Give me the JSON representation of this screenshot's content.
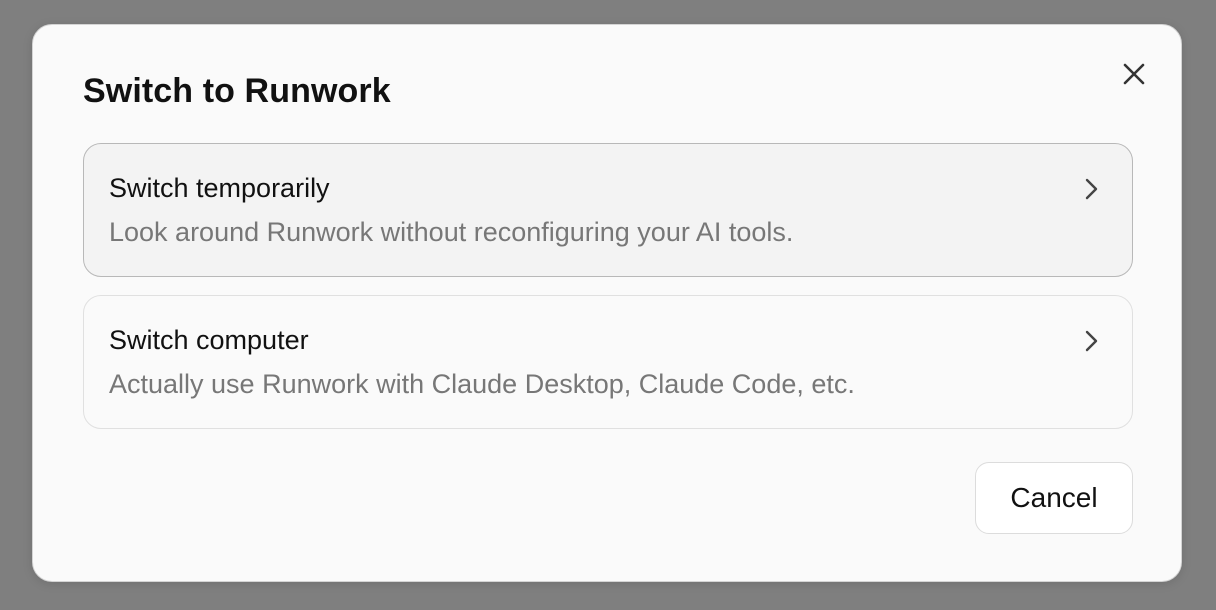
{
  "dialog": {
    "title": "Switch to Runwork",
    "close_icon": "close-icon",
    "options": [
      {
        "title": "Switch temporarily",
        "description": "Look around Runwork without reconfiguring your AI tools.",
        "icon": "chevron-right-icon",
        "state": "hovered"
      },
      {
        "title": "Switch computer",
        "description": "Actually use Runwork with Claude Desktop, Claude Code, etc.",
        "icon": "chevron-right-icon",
        "state": "normal"
      }
    ],
    "cancel_label": "Cancel"
  },
  "colors": {
    "backdrop": "#7f7f7f",
    "dialog_background": "#fafafa",
    "hovered_card_background": "#f3f3f3",
    "title_text": "#111111",
    "description_text": "#777777"
  }
}
